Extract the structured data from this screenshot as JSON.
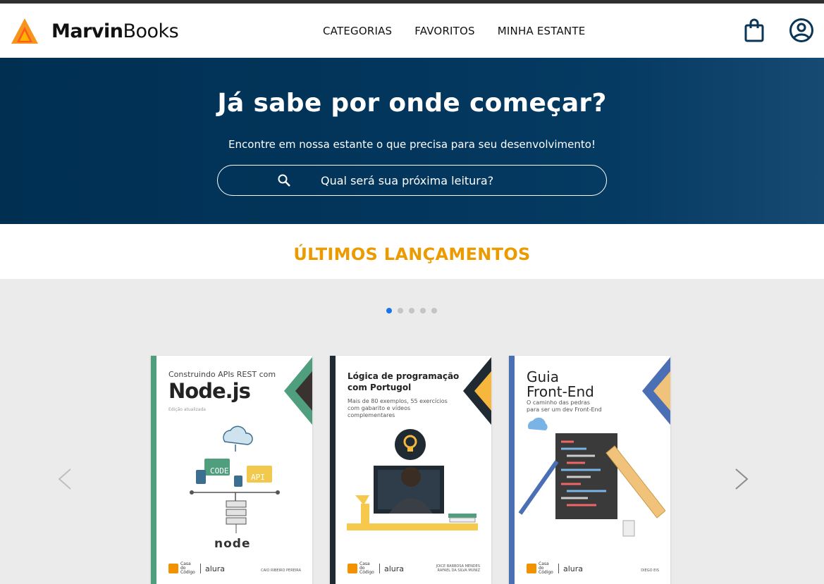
{
  "header": {
    "logo_bold": "Marvin",
    "logo_regular": "Books",
    "nav": [
      "CATEGORIAS",
      "FAVORITOS",
      "MINHA ESTANTE"
    ]
  },
  "hero": {
    "title": "Já sabe por onde começar?",
    "subtitle": "Encontre em nossa estante o que precisa para seu desenvolvimento!",
    "search_placeholder": "Qual será sua próxima leitura?"
  },
  "releases": {
    "title": "ÚLTIMOS LANÇAMENTOS",
    "active_dot": 1,
    "dot_count": 5
  },
  "books": [
    {
      "title_small": "Construindo APIs REST com",
      "title_big": "Node.js",
      "edition": "Edição atualizada",
      "badge_code": "CODE",
      "badge_api": "API",
      "tech": "node",
      "publisher_name": "Casa do Código",
      "publisher_brand": "alura",
      "author": "CAIO RIBEIRO PEREIRA"
    },
    {
      "title": "Lógica de programação com Portugol",
      "subtitle": "Mais de 80 exemplos, 55 exercícios com gabarito e vídeos complementares",
      "publisher_name": "Casa do Código",
      "publisher_brand": "alura",
      "author_line1": "JOICE BARBOSA MENDES",
      "author_line2": "RAFAEL DA SILVA MUNIZ"
    },
    {
      "title_line1": "Guia",
      "title_line2": "Front-End",
      "subtitle": "O caminho das pedras para ser um dev Front-End",
      "publisher_name": "Casa do Código",
      "publisher_brand": "alura",
      "author": "DIEGO EIS"
    }
  ],
  "colors": {
    "accent": "#eb9b00",
    "hero_bg": "#002f52",
    "logo_orange": "#f7941d",
    "dot_active": "#1a73e8"
  }
}
